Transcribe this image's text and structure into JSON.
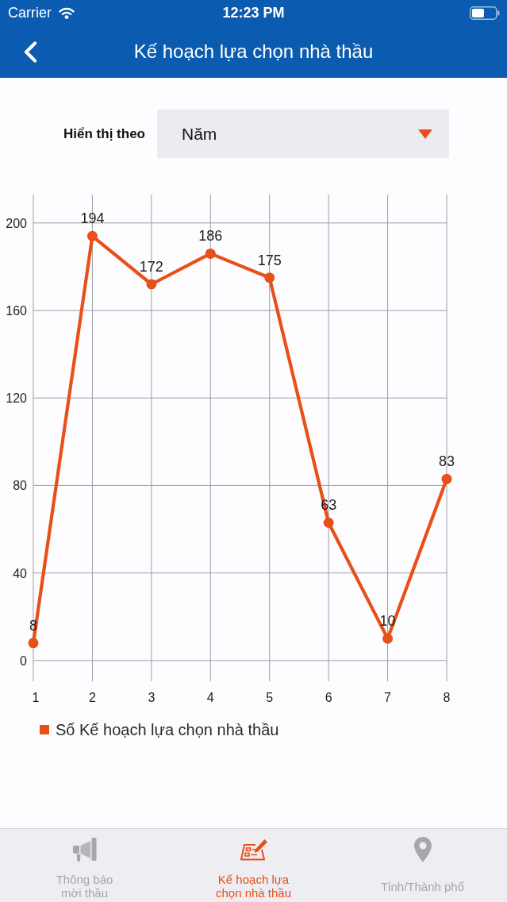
{
  "status_bar": {
    "carrier": "Carrier",
    "time": "12:23 PM"
  },
  "nav_bar": {
    "title": "Kế hoạch lựa chọn nhà thầu"
  },
  "filter": {
    "label": "Hiển thị theo",
    "dropdown": {
      "value": "Năm"
    }
  },
  "chart_data": {
    "type": "line",
    "categories": [
      "1",
      "2",
      "3",
      "4",
      "5",
      "6",
      "7",
      "8"
    ],
    "series": [
      {
        "name": "Số Kế hoạch lựa chọn nhà thầu",
        "color": "#e8501a",
        "marker": "circle",
        "values": [
          8,
          194,
          172,
          186,
          175,
          63,
          10,
          83
        ]
      }
    ],
    "ylim": [
      -9.5,
      213
    ],
    "yticks": [
      0,
      40,
      80,
      120,
      160,
      200
    ],
    "grid": true,
    "data_labels": true
  },
  "tab_bar": {
    "items": [
      {
        "label": "Thông báo\nmời thầu",
        "selected": false
      },
      {
        "label": "Kế hoạch lựa\nchọn nhà thầu",
        "selected": true
      },
      {
        "label": "Tỉnh/Thành phố",
        "selected": false
      }
    ]
  }
}
